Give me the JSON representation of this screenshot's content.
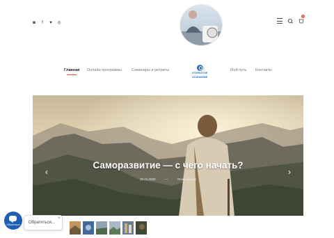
{
  "header": {
    "social_icons": [
      "instagram-icon",
      "facebook-icon",
      "twitter-icon",
      "pinterest-icon"
    ],
    "social_glyphs": [
      "◙",
      "f",
      "♥",
      "◎"
    ],
    "right_icons": [
      "menu-icon",
      "search-icon",
      "cart-icon"
    ],
    "cart_count": "0"
  },
  "nav": {
    "items": [
      "Главная",
      "Онлайн программы",
      "Семинары и ретриты",
      "Мой путь",
      "Контакты"
    ],
    "logo_lines": [
      "ОТКРЫТОЕ",
      "СОЗНАНИЕ"
    ]
  },
  "hero": {
    "title": "Саморазвитие — с чего начать?",
    "date": "30.01.2020",
    "separator": "—",
    "category": "Точки зрения",
    "prev_arrow": "‹",
    "next_arrow": "›"
  },
  "thumbnails_count": 6,
  "chat": {
    "button_label": "Обратиться",
    "box_text": "Обратиться...",
    "close_glyph": "×"
  },
  "colors": {
    "accent": "#e8572b",
    "brand_blue": "#2a73b8",
    "chat_blue": "#1e5fb0"
  }
}
